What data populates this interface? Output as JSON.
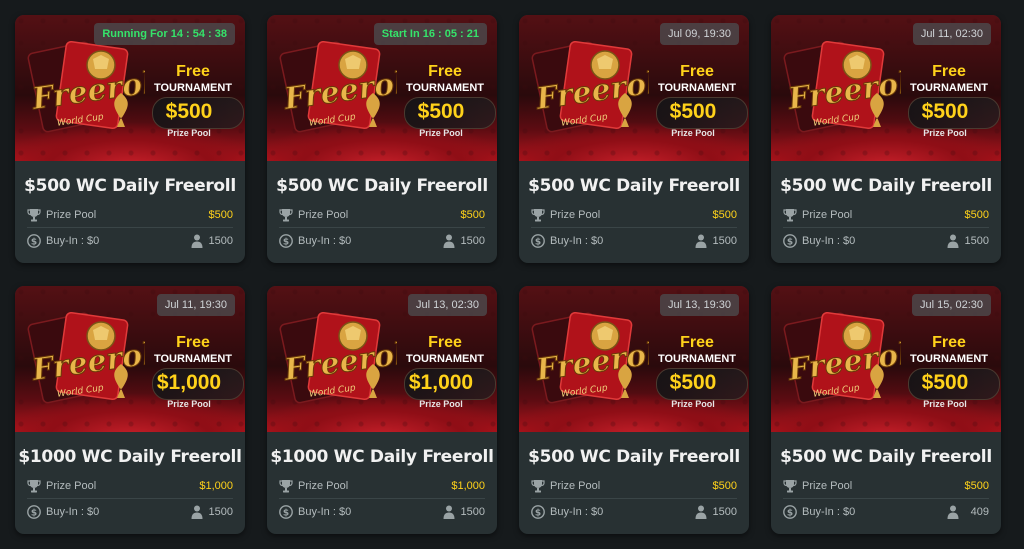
{
  "banner": {
    "free_label": "Free",
    "tournament_label": "TOURNAMENT",
    "prize_pool_label": "Prize Pool",
    "logo_text": "Freeroll",
    "logo_subtext": "World Cup"
  },
  "labels": {
    "prize_pool": "Prize Pool",
    "buy_in": "Buy-In :",
    "buy_in_value": "$0"
  },
  "colors": {
    "accent_yellow": "#ffd21a",
    "timer_green": "#35e36a",
    "card_bg": "#283133",
    "page_bg": "#161a1c"
  },
  "cards": [
    {
      "badge": "Running For 14 : 54 : 38",
      "badge_style": "green",
      "amount": "$500",
      "title": "$500 WC Daily Freeroll",
      "prize": "$500",
      "players": "1500"
    },
    {
      "badge": "Start In 16 : 05 : 21",
      "badge_style": "green",
      "amount": "$500",
      "title": "$500 WC Daily Freeroll",
      "prize": "$500",
      "players": "1500"
    },
    {
      "badge": "Jul 09, 19:30",
      "badge_style": "gray",
      "amount": "$500",
      "title": "$500 WC Daily Freeroll",
      "prize": "$500",
      "players": "1500"
    },
    {
      "badge": "Jul 11, 02:30",
      "badge_style": "gray",
      "amount": "$500",
      "title": "$500 WC Daily Freeroll",
      "prize": "$500",
      "players": "1500"
    },
    {
      "badge": "Jul 11, 19:30",
      "badge_style": "gray",
      "amount": "$1,000",
      "title": "$1000 WC Daily Freeroll",
      "prize": "$1,000",
      "players": "1500"
    },
    {
      "badge": "Jul 13, 02:30",
      "badge_style": "gray",
      "amount": "$1,000",
      "title": "$1000 WC Daily Freeroll",
      "prize": "$1,000",
      "players": "1500"
    },
    {
      "badge": "Jul 13, 19:30",
      "badge_style": "gray",
      "amount": "$500",
      "title": "$500 WC Daily Freeroll",
      "prize": "$500",
      "players": "1500"
    },
    {
      "badge": "Jul 15, 02:30",
      "badge_style": "gray",
      "amount": "$500",
      "title": "$500 WC Daily Freeroll",
      "prize": "$500",
      "players": "409"
    }
  ]
}
